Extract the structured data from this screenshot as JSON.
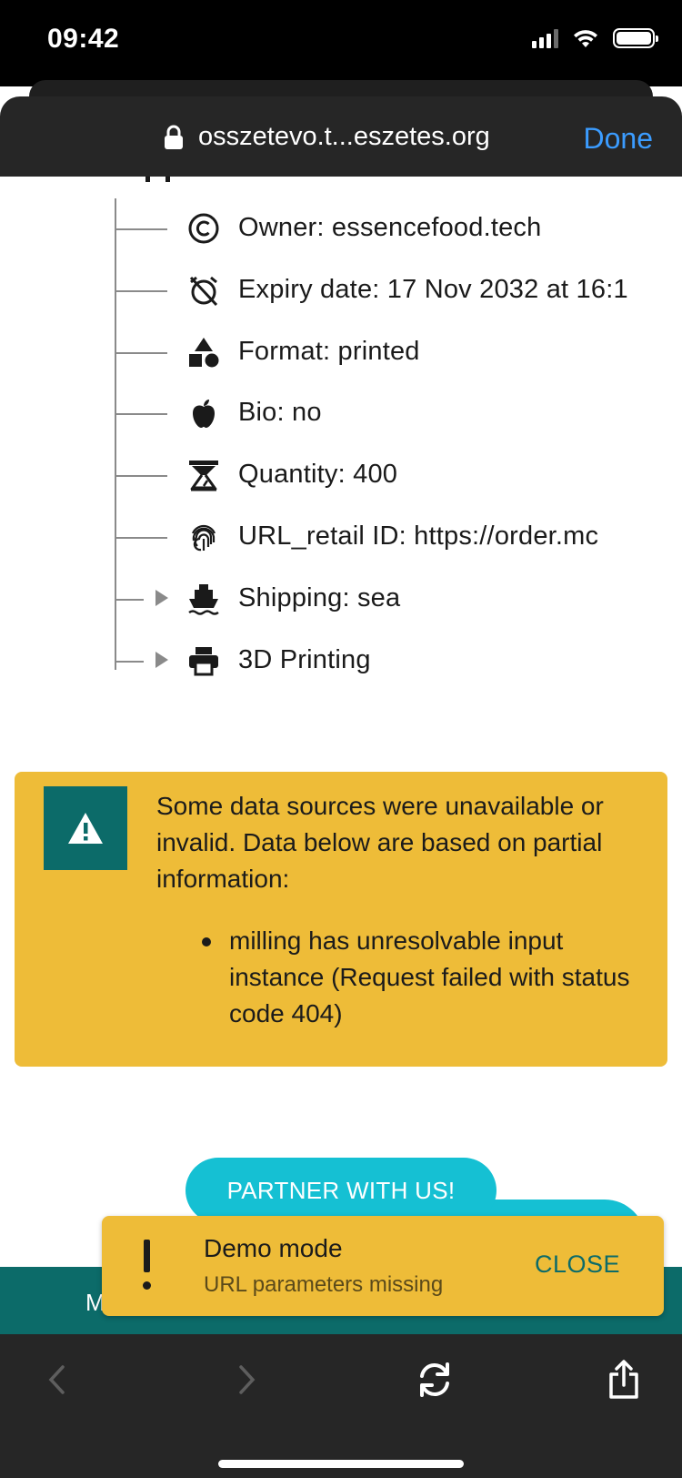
{
  "status_bar": {
    "time": "09:42"
  },
  "browser": {
    "url": "osszetevo.t...eszetes.org",
    "done_label": "Done"
  },
  "tree": {
    "rows": [
      {
        "label": "Owner: essencefood.tech",
        "icon": "copyright-icon"
      },
      {
        "label": "Expiry date: 17 Nov 2032 at 16:1",
        "icon": "alarm-off-icon"
      },
      {
        "label": "Format: printed",
        "icon": "shapes-icon"
      },
      {
        "label": "Bio: no",
        "icon": "apple-icon"
      },
      {
        "label": "Quantity: 400",
        "icon": "scale-icon"
      },
      {
        "label": "URL_retail ID: https://order.mc",
        "icon": "fingerprint-icon"
      },
      {
        "label": "Shipping: sea",
        "icon": "ship-icon",
        "expandable": true
      },
      {
        "label": "3D Printing",
        "icon": "printer-icon",
        "expandable": true
      }
    ]
  },
  "warning": {
    "message": "Some data sources were unavailable or invalid. Data below are based on partial information:",
    "items": [
      "milling has unresolvable input instance (Request failed with status code 404)"
    ],
    "icon": "warning-triangle-icon",
    "color": "#eebc38"
  },
  "partner": {
    "label": "PARTNER WITH US!"
  },
  "footer": {
    "letter": "M"
  },
  "snackbar": {
    "title": "Demo mode",
    "subtitle": "URL parameters missing",
    "close_label": "CLOSE"
  },
  "colors": {
    "teal": "#0c6b69",
    "cyan": "#15c0d3",
    "amber": "#eebc38",
    "link_blue": "#3b9cff"
  }
}
